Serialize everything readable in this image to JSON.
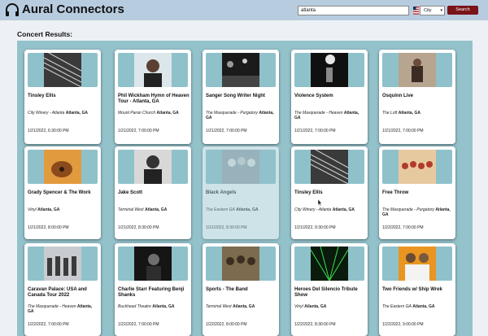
{
  "header": {
    "brand": "Aural Connectors",
    "logo_caption": "AuralConnectors",
    "search_value": "atlanta",
    "filter_selected": "City",
    "search_label": "Search"
  },
  "main": {
    "results_title": "Concert Results:"
  },
  "concerts": [
    {
      "title": "Tinsley Ellis",
      "venue": "City Winery - Atlanta",
      "location": "Atlanta, GA",
      "date": "1/21/2022, 6:30:00 PM",
      "image": "guitar-strings",
      "faded": false
    },
    {
      "title": "Phil Wickham Hymn of Heaven Tour - Atlanta, GA",
      "venue": "Mount Paran Church",
      "location": "Atlanta, GA",
      "date": "1/21/2022, 7:00:00 PM",
      "image": "man-portrait",
      "faded": false
    },
    {
      "title": "Sanger Song Writer Night",
      "venue": "The Masquerade - Purgatory",
      "location": "Atlanta, GA",
      "date": "1/21/2022, 7:00:00 PM",
      "image": "concert-crowd",
      "faded": false
    },
    {
      "title": "Violence System",
      "venue": "The Masquerade - Heaven",
      "location": "Atlanta, GA",
      "date": "1/21/2022, 7:00:00 PM",
      "image": "stage-performer",
      "faded": false
    },
    {
      "title": "Osquinn Live",
      "venue": "The Loft",
      "location": "Atlanta, GA",
      "date": "1/21/2022, 7:00:00 PM",
      "image": "artist-room",
      "faded": false
    },
    {
      "title": "Grady Spencer & The Work",
      "venue": "Vinyl",
      "location": "Atlanta, GA",
      "date": "1/21/2022, 8:00:00 PM",
      "image": "acoustic-guitar",
      "faded": false
    },
    {
      "title": "Jake Scott",
      "venue": "Terminal West",
      "location": "Atlanta, GA",
      "date": "1/21/2022, 8:30:00 PM",
      "image": "man-bw",
      "faded": false
    },
    {
      "title": "Black Angels",
      "venue": "The Eastern GA",
      "location": "Atlanta, GA",
      "date": "1/21/2022, 8:30:00 PM",
      "image": "band-photo",
      "faded": true
    },
    {
      "title": "Tinsley Ellis",
      "venue": "City Winery - Atlanta",
      "location": "Atlanta, GA",
      "date": "1/21/2022, 9:30:00 PM",
      "image": "guitar-strings",
      "faded": false
    },
    {
      "title": "Free Throw",
      "venue": "The Masquerade - Purgatory",
      "location": "Atlanta, GA",
      "date": "1/22/2022, 7:00:00 PM",
      "image": "band-group",
      "faded": false
    },
    {
      "title": "Caravan Palace: USA and Canada Tour 2022",
      "venue": "The Masquerade - Heaven",
      "location": "Atlanta, GA",
      "date": "1/22/2022, 7:00:00 PM",
      "image": "band-wall",
      "faded": false
    },
    {
      "title": "Charlie Starr Featuring Benji Shanks",
      "venue": "Buckhead Theatre",
      "location": "Atlanta, GA",
      "date": "1/22/2022, 7:00:00 PM",
      "image": "dark-portrait",
      "faded": false
    },
    {
      "title": "Sports - The Band",
      "venue": "Terminal West",
      "location": "Atlanta, GA",
      "date": "1/22/2022, 8:00:00 PM",
      "image": "band-outdoors",
      "faded": false
    },
    {
      "title": "Heroes Del Silencio Tribute Show",
      "venue": "Vinyl",
      "location": "Atlanta, GA",
      "date": "1/22/2022, 8:30:00 PM",
      "image": "green-lasers",
      "faded": false
    },
    {
      "title": "Two Friends w/ Ship Wrek",
      "venue": "The Eastern GA",
      "location": "Atlanta, GA",
      "date": "1/22/2022, 9:00:00 PM",
      "image": "two-friends",
      "faded": false
    }
  ]
}
